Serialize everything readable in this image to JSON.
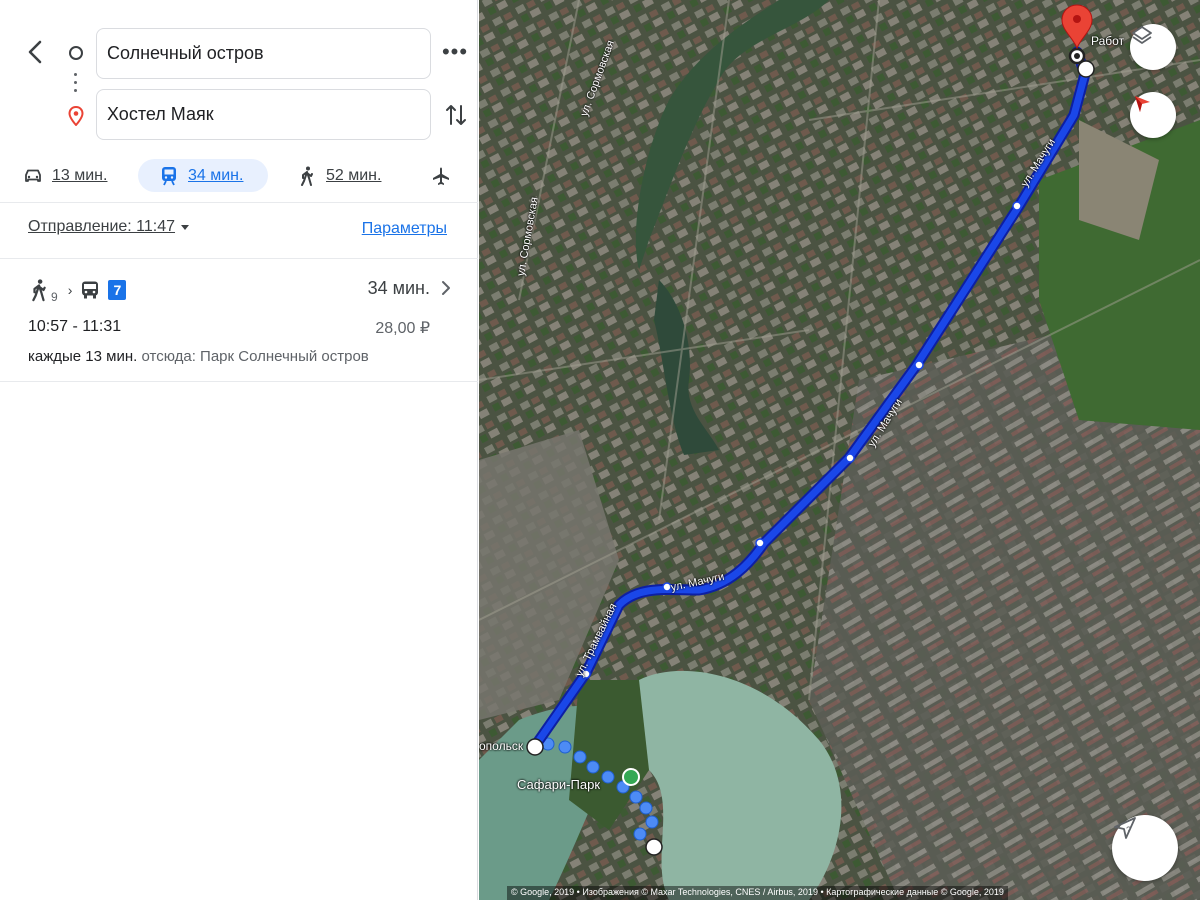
{
  "search": {
    "origin": "Солнечный остров",
    "destination": "Хостел Маяк"
  },
  "modes": {
    "car": "13 мин.",
    "transit": "34 мин.",
    "walk": "52 мин."
  },
  "departure": {
    "label": "Отправление: 11:47",
    "params_link": "Параметры"
  },
  "option": {
    "walk_minutes": "9",
    "line": "7",
    "duration": "34 мин.",
    "times": "10:57 - 11:31",
    "price": "28,00 ₽",
    "frequency": "каждые 13 мин.",
    "from_stop": "отсюда: Парк Солнечный остров"
  },
  "map": {
    "street_labels": {
      "machugi_top": "ул. Мачуги",
      "machugi_mid": "ул. Мачуги",
      "machugi_low": "ул. Мачуги",
      "tramvainaya": "ул. Трамвайная",
      "sormovskaya_1": "ул. Сормовская",
      "sormovskaya_2": "ул. Сормовская"
    },
    "edge_label_left": "опольск",
    "edge_label_top": "Работ",
    "poi": "Сафари-Парк",
    "copyright": "© Google, 2019 • Изображения © Maxar Technologies, CNES / Airbus, 2019 • Картографические данные © Google, 2019",
    "route_color": "#1a47e8",
    "walk_color": "#4d8bf5"
  }
}
